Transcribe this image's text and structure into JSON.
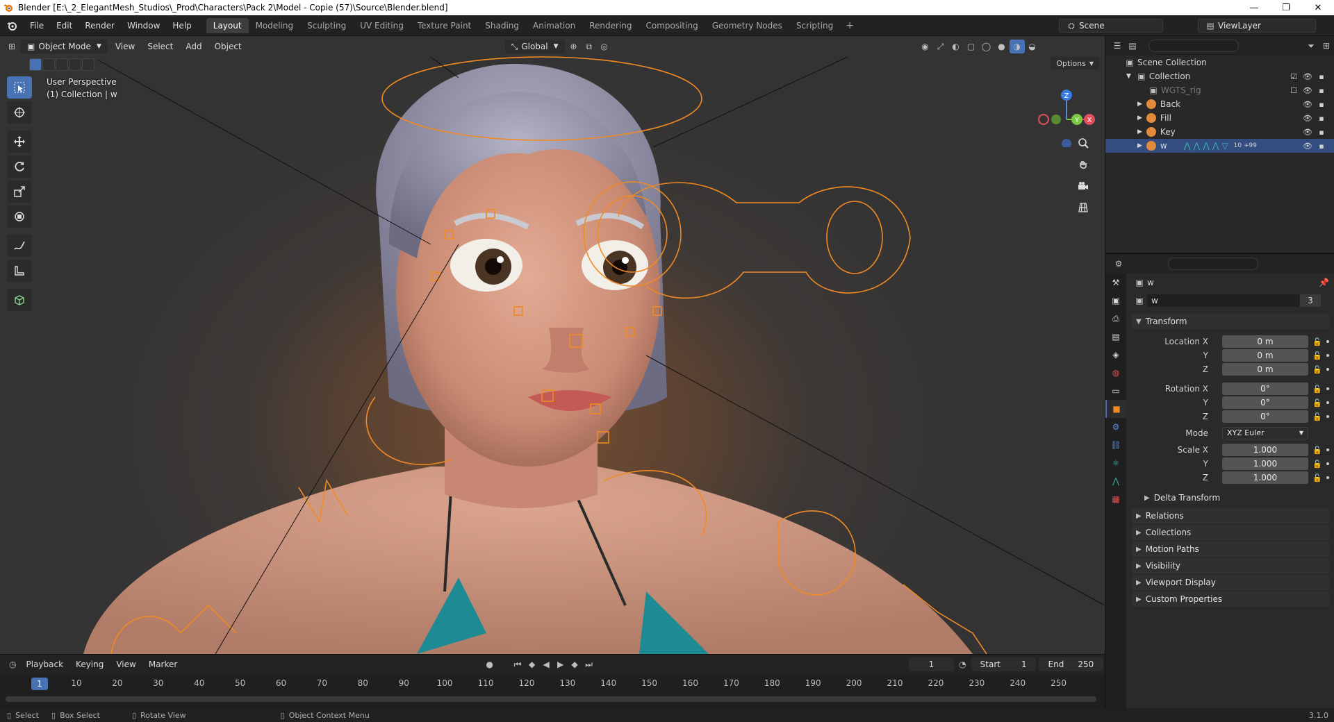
{
  "window": {
    "title": "Blender [E:\\_2_ElegantMesh_Studios\\_Prod\\Characters\\Pack 2\\Model - Copie (57)\\Source\\Blender.blend]",
    "minimize": "—",
    "maximize": "❐",
    "close": "✕"
  },
  "menu": {
    "file": "File",
    "edit": "Edit",
    "render": "Render",
    "window": "Window",
    "help": "Help"
  },
  "workspaces": [
    "Layout",
    "Modeling",
    "Sculpting",
    "UV Editing",
    "Texture Paint",
    "Shading",
    "Animation",
    "Rendering",
    "Compositing",
    "Geometry Nodes",
    "Scripting"
  ],
  "workspace_add": "+",
  "scene": {
    "name": "Scene",
    "view_layer": "ViewLayer"
  },
  "viewport": {
    "mode": "Object Mode",
    "menus": {
      "view": "View",
      "select": "Select",
      "add": "Add",
      "object": "Object"
    },
    "orientation": "Global",
    "options": "Options",
    "info_line1": "User Perspective",
    "info_line2": "(1) Collection | w",
    "gizmo": {
      "z": "Z",
      "y": "Y",
      "x": "X"
    }
  },
  "timeline": {
    "playback": "Playback",
    "keying": "Keying",
    "view": "View",
    "marker": "Marker",
    "current_frame": "1",
    "start_label": "Start",
    "start": "1",
    "end_label": "End",
    "end": "250",
    "ruler": [
      "1",
      "10",
      "20",
      "30",
      "40",
      "50",
      "60",
      "70",
      "80",
      "90",
      "100",
      "110",
      "120",
      "130",
      "140",
      "150",
      "160",
      "170",
      "180",
      "190",
      "200",
      "210",
      "220",
      "230",
      "240",
      "250"
    ]
  },
  "statusbar": {
    "select": "Select",
    "box_select": "Box Select",
    "rotate_view": "Rotate View",
    "context_menu": "Object Context Menu",
    "version": "3.1.0"
  },
  "outliner": {
    "scene_collection": "Scene Collection",
    "collection": "Collection",
    "items": [
      {
        "name": "WGTS_rig",
        "dim": true
      },
      {
        "name": "Back",
        "dim": false
      },
      {
        "name": "Fill",
        "dim": false
      },
      {
        "name": "Key",
        "dim": false
      },
      {
        "name": "w",
        "dim": false,
        "extra": "10 +99"
      }
    ]
  },
  "properties": {
    "object_name": "w",
    "data_name": "w",
    "users": "3",
    "transform": "Transform",
    "location_label": "Location X",
    "location": [
      "0 m",
      "0 m",
      "0 m"
    ],
    "rotation_label": "Rotation X",
    "rotation": [
      "0°",
      "0°",
      "0°"
    ],
    "mode_label": "Mode",
    "mode": "XYZ Euler",
    "scale_label": "Scale X",
    "scale": [
      "1.000",
      "1.000",
      "1.000"
    ],
    "axis_y": "Y",
    "axis_z": "Z",
    "delta_transform": "Delta Transform",
    "panels": [
      "Relations",
      "Collections",
      "Motion Paths",
      "Visibility",
      "Viewport Display",
      "Custom Properties"
    ]
  },
  "colors": {
    "accent": "#4772b3",
    "selection_wire": "#f08a24",
    "bg": "#303030"
  }
}
